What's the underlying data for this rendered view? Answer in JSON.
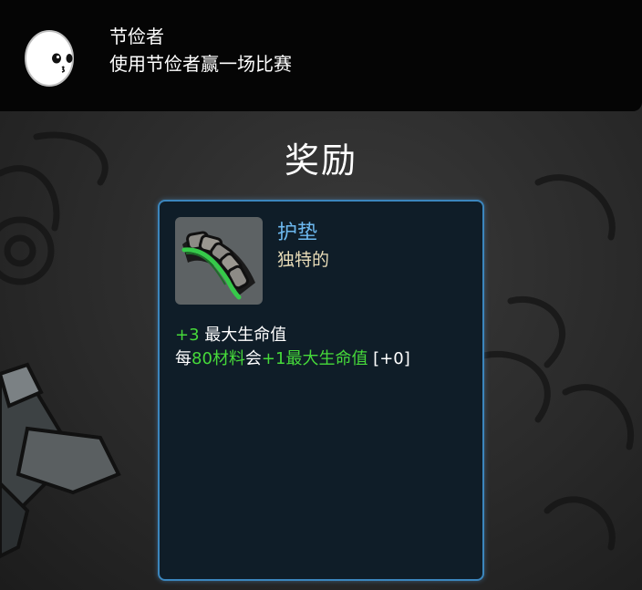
{
  "achievement": {
    "title": "节俭者",
    "description": "使用节俭者赢一场比赛",
    "icon": "egg-face-icon"
  },
  "reward_heading": "奖励",
  "item": {
    "icon": "padding-item-icon",
    "name": "护垫",
    "rarity": "独特的",
    "stat1_value": "+3",
    "stat1_text": " 最大生命值",
    "stat2_prefix": "每",
    "stat2_amount": "80材料",
    "stat2_mid": "会",
    "stat2_bonus": "+1最大生命值",
    "stat2_current": " [+0]"
  },
  "colors": {
    "positive": "#46d93a",
    "item_name": "#6db9f0",
    "card_border": "#3b86bd"
  }
}
